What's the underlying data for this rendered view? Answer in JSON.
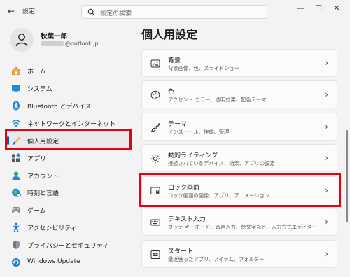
{
  "app": {
    "title": "設定"
  },
  "search": {
    "placeholder": "設定の検索"
  },
  "user": {
    "name": "秋葉一郎",
    "email_suffix": "@outlook.jp"
  },
  "sidebar": {
    "items": [
      {
        "label": "ホーム",
        "icon": "home-icon"
      },
      {
        "label": "システム",
        "icon": "system-icon"
      },
      {
        "label": "Bluetooth とデバイス",
        "icon": "bluetooth-icon"
      },
      {
        "label": "ネットワークとインターネット",
        "icon": "network-icon"
      },
      {
        "label": "個人用設定",
        "icon": "personalization-icon",
        "active": true
      },
      {
        "label": "アプリ",
        "icon": "apps-icon"
      },
      {
        "label": "アカウント",
        "icon": "account-icon"
      },
      {
        "label": "時刻と言語",
        "icon": "time-language-icon"
      },
      {
        "label": "ゲーム",
        "icon": "gaming-icon"
      },
      {
        "label": "アクセシビリティ",
        "icon": "accessibility-icon"
      },
      {
        "label": "プライバシーとセキュリティ",
        "icon": "privacy-shield-icon"
      },
      {
        "label": "Windows Update",
        "icon": "windows-update-icon"
      }
    ]
  },
  "main": {
    "title": "個人用設定",
    "cards": [
      {
        "title": "背景",
        "subtitle": "背景画像、色、スライドショー",
        "icon": "background-image-icon"
      },
      {
        "title": "色",
        "subtitle": "アクセント カラー、透明効果、配色テーマ",
        "icon": "palette-icon"
      },
      {
        "title": "テーマ",
        "subtitle": "インストール、作成、管理",
        "icon": "brush-icon"
      },
      {
        "title": "動的ライティング",
        "subtitle": "接続されているデバイス、効果、アプリの設定",
        "icon": "dynamic-lighting-icon"
      },
      {
        "title": "ロック画面",
        "subtitle": "ロック画面の画像、アプリ、アニメーション",
        "icon": "lock-screen-icon"
      },
      {
        "title": "テキスト入力",
        "subtitle": "タッチ キーボード、音声入力、絵文字など、入力方式エディター",
        "icon": "keyboard-icon"
      },
      {
        "title": "スタート",
        "subtitle": "最近使ったアプリ、アイテム、フォルダー",
        "icon": "start-menu-icon"
      }
    ]
  },
  "colors": {
    "accent": "#005fb8",
    "highlight": "#e60012"
  }
}
